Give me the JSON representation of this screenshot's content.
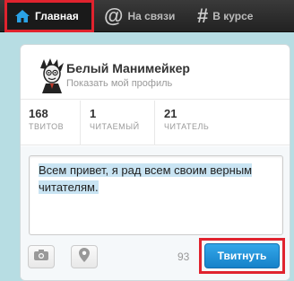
{
  "nav": {
    "home": {
      "label": "Главная",
      "icon": "home-icon"
    },
    "connect": {
      "label": "На связи",
      "icon": "at-icon"
    },
    "discover": {
      "label": "В курсе",
      "icon": "hash-icon"
    },
    "accent": "#e0232e"
  },
  "profile": {
    "name": "Белый Манимейкер",
    "link": "Показать мой профиль"
  },
  "stats": [
    {
      "value": "168",
      "label": "ТВИТОВ"
    },
    {
      "value": "1",
      "label": "ЧИТАЕМЫЙ"
    },
    {
      "value": "21",
      "label": "ЧИТАТЕЛЬ"
    }
  ],
  "composer": {
    "text": "Всем привет, я рад всем своим верным читателям.",
    "counter": "93",
    "tweet_label": "Твитнуть",
    "tools": [
      "camera-icon",
      "location-pin-icon"
    ]
  }
}
